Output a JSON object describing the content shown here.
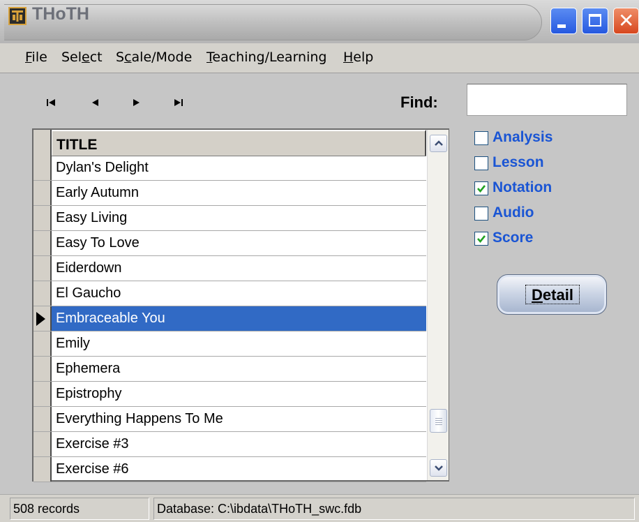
{
  "window": {
    "title": "THoTH",
    "accent_color": "#316ac5",
    "label_color": "#1a55d4"
  },
  "menu": {
    "items": [
      {
        "first": "F",
        "rest": "ile"
      },
      {
        "first": "Sel",
        "ul": "e",
        "rest": "ct"
      },
      {
        "first": "S",
        "ul": "c",
        "rest": "ale/Mode"
      },
      {
        "first": "",
        "ul": "T",
        "rest": "eaching/Learning"
      },
      {
        "first": "",
        "ul": "H",
        "rest": "elp"
      }
    ]
  },
  "toolbar": {
    "nav": [
      "first-record-icon",
      "prior-record-icon",
      "next-record-icon",
      "last-record-icon"
    ],
    "find_label": "Find:",
    "find_value": ""
  },
  "grid": {
    "column_title": "TITLE",
    "rows": [
      {
        "title": "Dylan's Delight",
        "selected": false
      },
      {
        "title": "Early Autumn",
        "selected": false
      },
      {
        "title": "Easy Living",
        "selected": false
      },
      {
        "title": "Easy To Love",
        "selected": false
      },
      {
        "title": "Eiderdown",
        "selected": false
      },
      {
        "title": "El Gaucho",
        "selected": false
      },
      {
        "title": "Embraceable You",
        "selected": true
      },
      {
        "title": "Emily",
        "selected": false
      },
      {
        "title": "Ephemera",
        "selected": false
      },
      {
        "title": "Epistrophy",
        "selected": false
      },
      {
        "title": "Everything Happens To Me",
        "selected": false
      },
      {
        "title": "Exercise #3",
        "selected": false
      },
      {
        "title": "Exercise #6",
        "selected": false
      }
    ]
  },
  "filters": [
    {
      "label": "Analysis",
      "checked": false
    },
    {
      "label": "Lesson",
      "checked": false
    },
    {
      "label": "Notation",
      "checked": true
    },
    {
      "label": "Audio",
      "checked": false
    },
    {
      "label": "Score",
      "checked": true
    }
  ],
  "detail_button": {
    "underlined": "D",
    "rest": "etail"
  },
  "status": {
    "records": "508 records",
    "database": "Database: C:\\ibdata\\THoTH_swc.fdb"
  }
}
